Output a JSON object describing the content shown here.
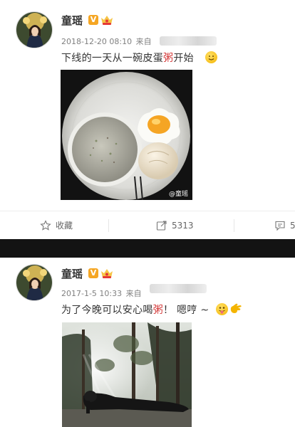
{
  "posts": [
    {
      "username": "童瑶",
      "verified_badge": "V",
      "timestamp": "2018-12-20 08:10",
      "source_prefix": "来自",
      "text_before": "下线的一天从一碗皮蛋",
      "text_highlight": "粥",
      "text_after": "开始",
      "emoji": "smile-emoji",
      "photo_watermark": "@童瑶",
      "actions": {
        "favorite_label": "收藏",
        "repost_count": "5313",
        "comment_count": "5"
      }
    },
    {
      "username": "童瑶",
      "verified_badge": "V",
      "timestamp": "2017-1-5 10:33",
      "source_prefix": "来自",
      "text_before": "为了今晚可以安心喝",
      "text_highlight": "粥",
      "text_after": "！ 嗯哼 ~",
      "emoji": "tongue-emoji"
    }
  ],
  "colors": {
    "badge": "#f5a623",
    "highlight": "#d43a3a",
    "divider": "#131313",
    "meta": "#808080"
  }
}
